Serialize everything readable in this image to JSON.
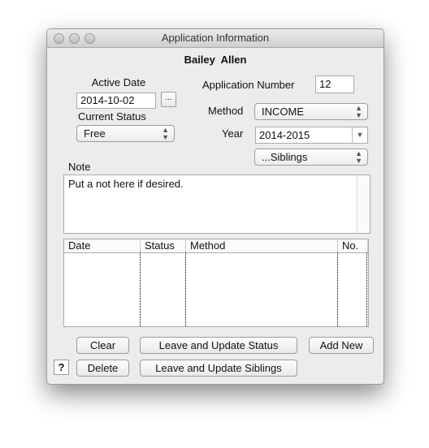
{
  "window": {
    "title": "Application Information"
  },
  "name": "Bailey  Allen",
  "active_date": {
    "label": "Active Date",
    "value": "2014-10-02",
    "picker_label": "..."
  },
  "current_status": {
    "label": "Current Status",
    "value": "Free"
  },
  "application_number": {
    "label": "Application Number",
    "value": "12"
  },
  "method": {
    "label": "Method",
    "value": "INCOME"
  },
  "year": {
    "label": "Year",
    "value": "2014-2015"
  },
  "siblings": {
    "value": "...Siblings"
  },
  "note": {
    "label": "Note",
    "value": "Put a not here if desired."
  },
  "table": {
    "columns": [
      "Date",
      "Status",
      "Method",
      "No."
    ],
    "rows": []
  },
  "buttons": {
    "clear": "Clear",
    "leave_status": "Leave and Update Status",
    "add_new": "Add New",
    "delete": "Delete",
    "leave_siblings": "Leave and Update Siblings",
    "help": "?"
  }
}
